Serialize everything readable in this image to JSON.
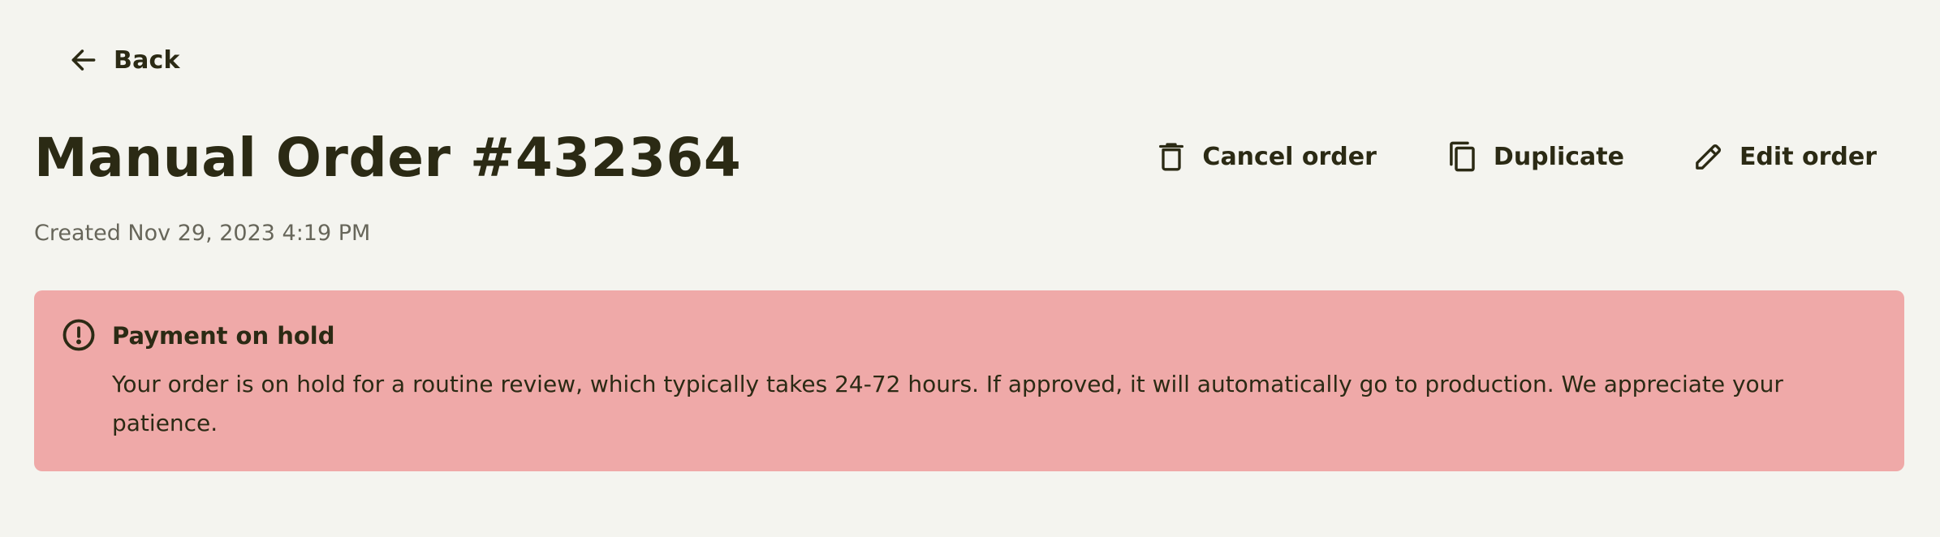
{
  "nav": {
    "back_label": "Back"
  },
  "header": {
    "title": "Manual Order #432364",
    "created": "Created Nov 29, 2023 4:19 PM"
  },
  "actions": [
    {
      "label": "Cancel order",
      "icon": "trash-icon"
    },
    {
      "label": "Duplicate",
      "icon": "copy-icon"
    },
    {
      "label": "Edit order",
      "icon": "pencil-icon"
    }
  ],
  "alert": {
    "icon": "alert-circle-icon",
    "title": "Payment on hold",
    "body": "Your order is on hold for a routine review, which typically takes 24-72 hours. If approved, it will automatically go to production. We appreciate your patience."
  },
  "colors": {
    "background": "#f4f4ef",
    "text": "#2b2a14",
    "muted_text": "#67665a",
    "alert_background": "#efa9a8"
  }
}
